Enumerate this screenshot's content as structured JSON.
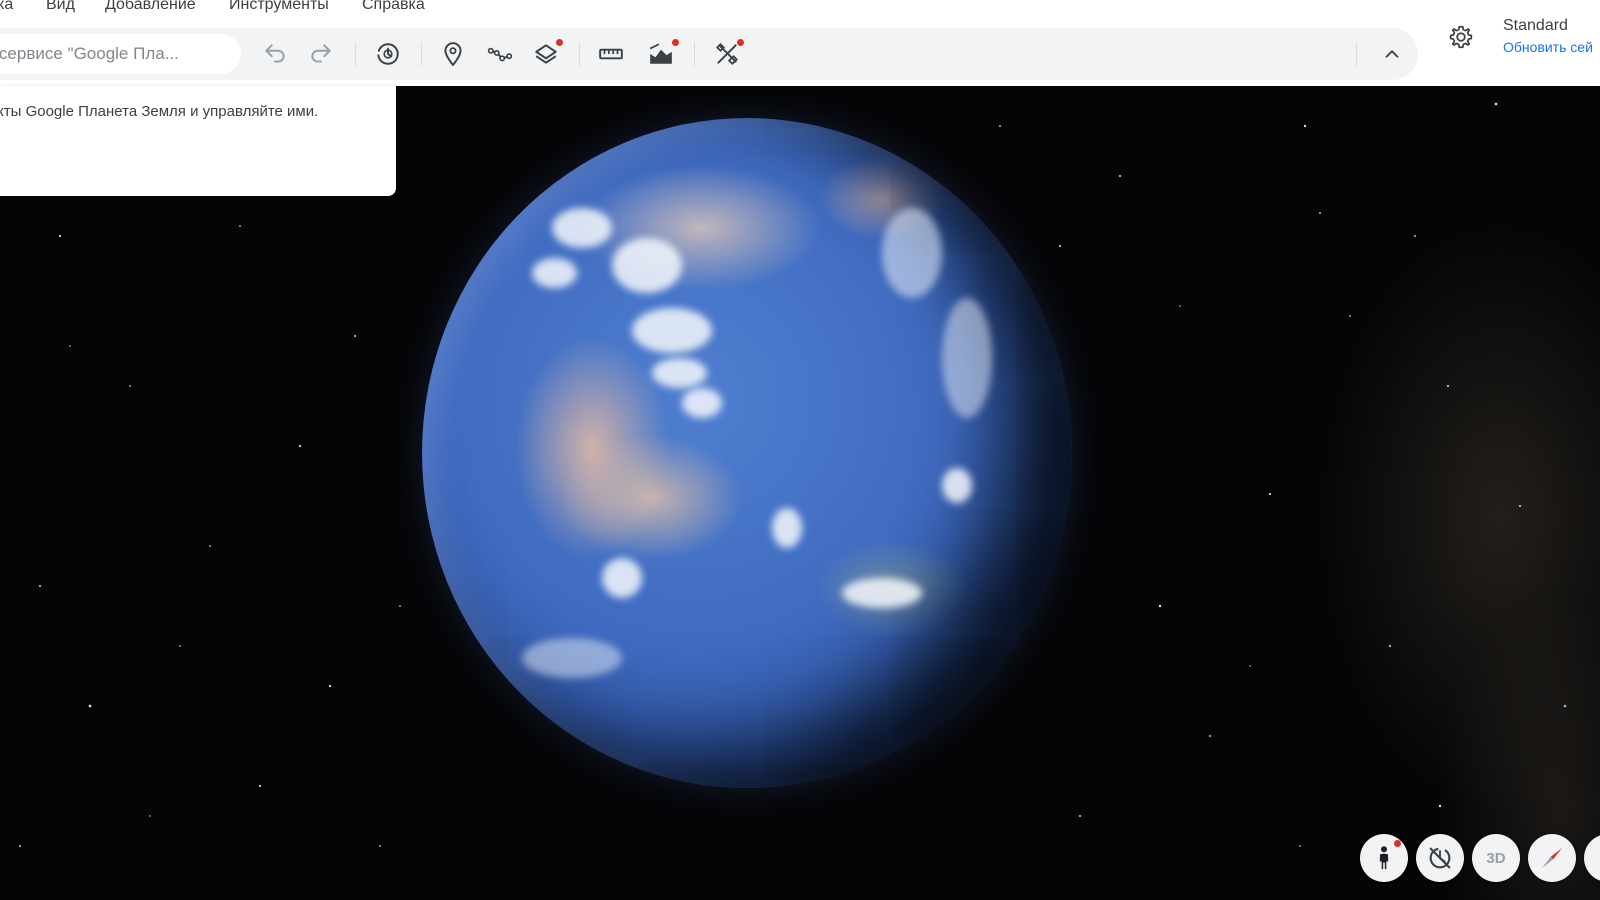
{
  "menu": {
    "items": [
      {
        "label": "ка"
      },
      {
        "label": "Вид"
      },
      {
        "label": "Добавление"
      },
      {
        "label": "Инструменты"
      },
      {
        "label": "Справка"
      }
    ]
  },
  "toolbar": {
    "search_placeholder": "к в сервисе \"Google Пла...",
    "buttons": {
      "undo": "undo-icon",
      "redo": "redo-icon",
      "history": "history-icon",
      "placemark": "placemark-icon",
      "path": "path-icon",
      "layers": "layers-icon",
      "ruler": "ruler-icon",
      "image_overlay": "image-overlay-icon",
      "tools": "tools-icon",
      "collapse": "chevron-up-icon"
    }
  },
  "map_style": {
    "title": "Standard",
    "link": "Обновить сей"
  },
  "info_card": {
    "text": "роекты Google Планета Земля и управляйте ими."
  },
  "controls": {
    "pegman": "pegman-icon",
    "rotation": "rotation-lock-icon",
    "three_d": "3D",
    "compass": "compass-icon"
  },
  "colors": {
    "accent": "#1a73e8",
    "notification_dot": "#d93025",
    "toolbar_bg": "#f1f3f4"
  }
}
